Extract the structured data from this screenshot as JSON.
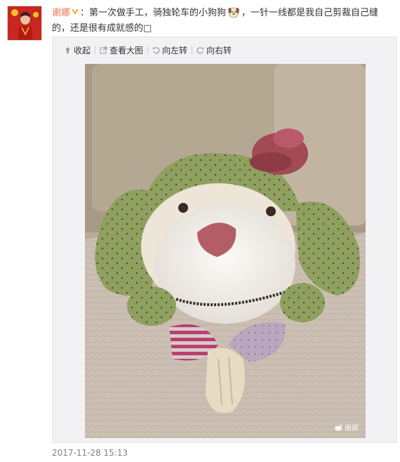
{
  "post": {
    "username": "谢娜",
    "text_part1": "：第一次做手工，骑独轮车的小狗狗",
    "text_part2": "，一针一线都是我自己剪裁自己缝的，还是很有成就感的",
    "text_trailing_glyph": "□",
    "timestamp": "2017-11-28 15:13"
  },
  "toolbar": {
    "collapse_label": "收起",
    "view_large_label": "查看大图",
    "rotate_left_label": "向左转",
    "rotate_right_label": "向右转"
  },
  "photo": {
    "watermark_text": "谢娜"
  },
  "icons": {
    "verified": "verified-v-icon",
    "emoji": "dog-emoji-icon",
    "collapse": "arrow-up-icon",
    "view_large": "external-view-icon",
    "rotate_left": "rotate-left-icon",
    "rotate_right": "rotate-right-icon"
  },
  "colors": {
    "username": "#eb7350",
    "timestamp": "#808080",
    "media_bg": "#f2f2f5"
  }
}
